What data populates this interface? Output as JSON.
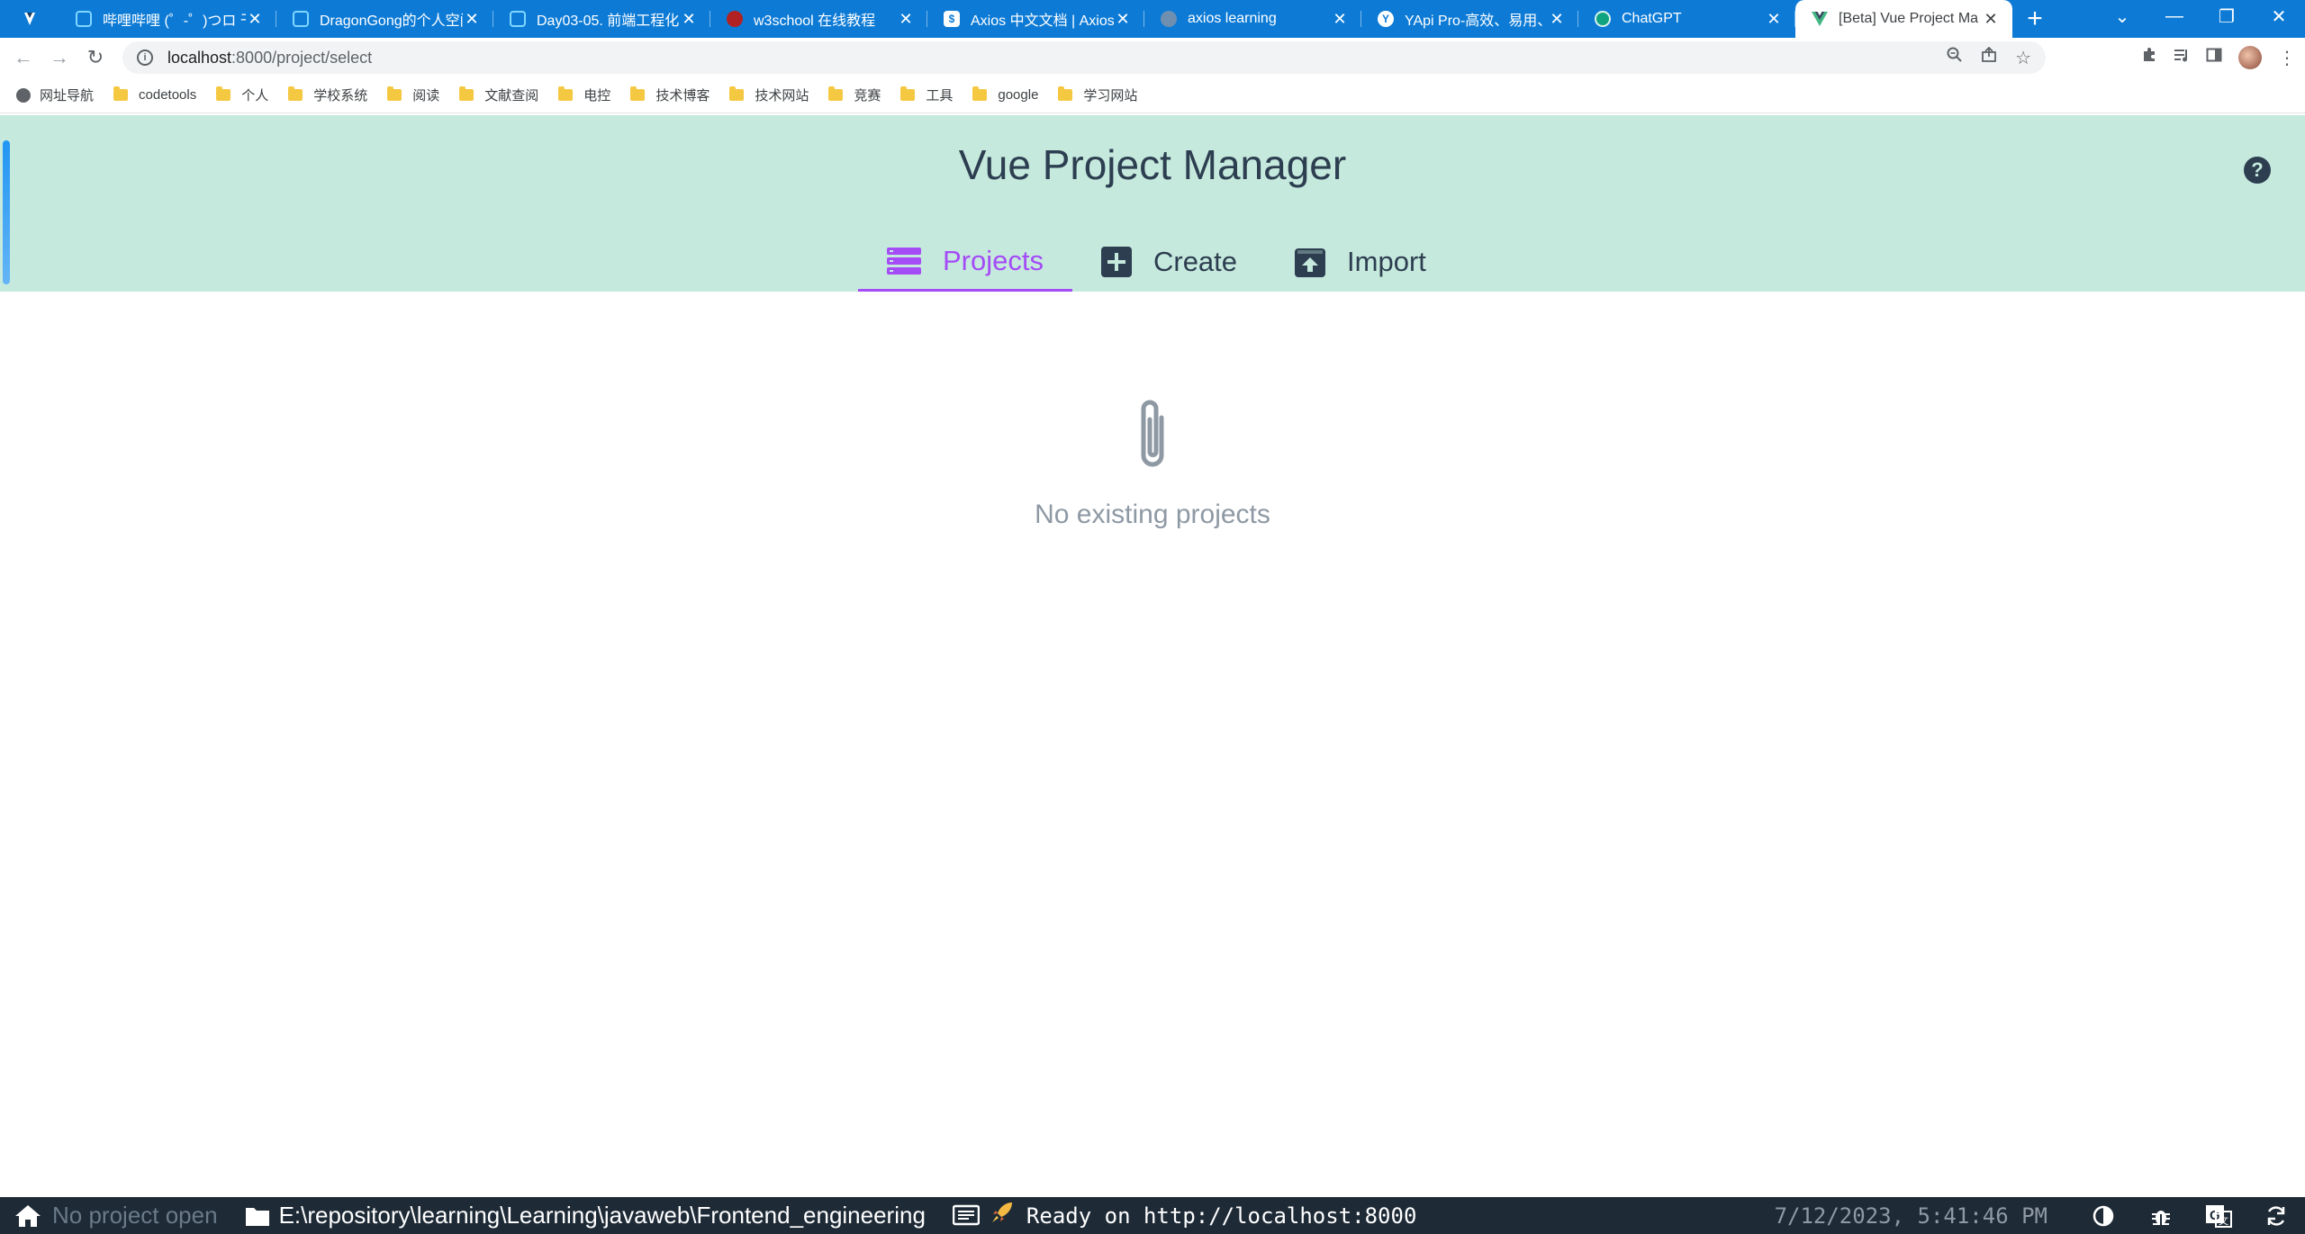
{
  "browser": {
    "tabs": [
      {
        "title": "哔哩哔哩 (゜-゜)つロ 干",
        "fav_color": "#00a1d6"
      },
      {
        "title": "DragonGong的个人空间",
        "fav_color": "#00a1d6"
      },
      {
        "title": "Day03-05. 前端工程化",
        "fav_color": "#00a1d6"
      },
      {
        "title": "w3school 在线教程",
        "fav_color": "#b22222"
      },
      {
        "title": "Axios 中文文档 | Axios",
        "fav_color": "#ffffff"
      },
      {
        "title": "axios learning",
        "fav_color": "#9aa0a6"
      },
      {
        "title": "YApi Pro-高效、易用、",
        "fav_color": "#ffffff"
      },
      {
        "title": "ChatGPT",
        "fav_color": "#10a37f"
      },
      {
        "title": "[Beta] Vue Project Ma",
        "fav_color": "#41b883"
      }
    ],
    "new_tab_label": "+",
    "url_host": "localhost",
    "url_path": ":8000/project/select"
  },
  "bookmarks": [
    "网址导航",
    "codetools",
    "个人",
    "学校系统",
    "阅读",
    "文献查阅",
    "电控",
    "技术博客",
    "技术网站",
    "竞赛",
    "工具",
    "google",
    "学习网站"
  ],
  "app": {
    "title": "Vue Project Manager",
    "help_label": "?",
    "tabs": {
      "projects": "Projects",
      "create": "Create",
      "import": "Import"
    },
    "empty_message": "No existing projects"
  },
  "statusbar": {
    "project": "No project open",
    "cwd": "E:\\repository\\learning\\Learning\\javaweb\\Frontend_engineering",
    "status": "Ready on http://localhost:8000",
    "timestamp": "7/12/2023, 5:41:46 PM"
  },
  "colors": {
    "tab_strip": "#0d7bd6",
    "header_bg": "#c6e9dd",
    "accent": "#a44cf6",
    "heading": "#2c3e50",
    "statusbar_bg": "#1e2a36"
  }
}
